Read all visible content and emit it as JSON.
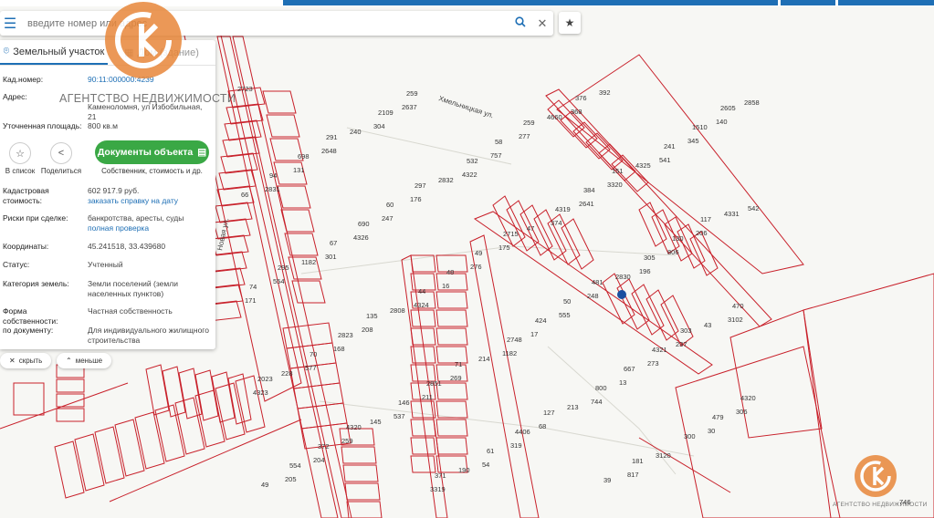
{
  "search": {
    "placeholder": "введите номер или адрес"
  },
  "tabs": [
    {
      "label": "Земельный участок"
    },
    {
      "label": "Дом (здание)"
    }
  ],
  "watermark": {
    "text": "АГЕНТСТВО НЕДВИЖИМОСТИ",
    "color": "#e8873a"
  },
  "info": {
    "cadnum_label": "Кад.номер:",
    "cadnum_value": "90:11:000000:4239",
    "address_label": "Адрес:",
    "address_value": "Каменоломня, ул Избобильная, 21",
    "area_label": "Уточненная площадь:",
    "area_value": "800 кв.м",
    "cost_label": "Кадастровая стоимость:",
    "cost_value": "602 917.9 руб.",
    "cost_link": "заказать справку на дату",
    "risks_label": "Риски при сделке:",
    "risks_value": "банкротства, аресты, суды",
    "risks_link": "полная проверка",
    "coords_label": "Координаты:",
    "coords_value": "45.241518, 33.439680",
    "status_label": "Статус:",
    "status_value": "Учтенный",
    "category_label": "Категория земель:",
    "category_value": "Земли поселений (земли населенных пунктов)",
    "ownership_label": "Форма собственности:",
    "ownership_value": "Частная собственность",
    "doc_label": "по документу:",
    "doc_value": "Для индивидуального жилищного строительства"
  },
  "actions": {
    "save_label": "В список",
    "share_label": "Поделиться",
    "docs_button": "Документы объекта",
    "docs_caption": "Собственник, стоимость и др."
  },
  "chips": {
    "hide": "скрыть",
    "less": "меньше"
  },
  "colors": {
    "accent": "#1e6fb5",
    "green": "#3aa845",
    "plot_line": "#c8202a",
    "marker": "#1a4fa0"
  },
  "streets": [
    "Хмельницкая ул.",
    "Новая ул."
  ],
  "plots": [
    "2723",
    "291",
    "297",
    "2715",
    "481",
    "303",
    "2023",
    "4320",
    "371",
    "259",
    "151",
    "117",
    "295",
    "135",
    "71",
    "127",
    "181",
    "2605",
    "698",
    "60",
    "49",
    "50",
    "4321",
    "4320",
    "372",
    "259",
    "58",
    "384",
    "130",
    "74",
    "2823",
    "2851",
    "4406",
    "39",
    "1510",
    "94",
    "690",
    "48",
    "424",
    "667",
    "479",
    "554",
    "2109",
    "532",
    "4319",
    "305",
    "470",
    "70",
    "146",
    "61",
    "376",
    "241",
    "66",
    "67",
    "44",
    "2748",
    "800",
    "300",
    "49",
    "240",
    "2832",
    "47",
    "2830",
    "43",
    "228",
    "145",
    "190",
    "4660",
    "4325",
    "4331",
    "1182",
    "2808",
    "214",
    "213",
    "3120",
    "2858",
    "2648",
    "176",
    "175",
    "248",
    "237",
    "4323",
    "259",
    "3319",
    "277",
    "3320",
    "206",
    "554",
    "208",
    "269",
    "68",
    "817",
    "140",
    "131",
    "247",
    "276",
    "555",
    "273",
    "306",
    "204",
    "2637",
    "757",
    "2641",
    "806",
    "171",
    "168",
    "211",
    "319",
    "392",
    "345",
    "2831",
    "4326",
    "16",
    "17",
    "13",
    "30",
    "205",
    "304",
    "4322",
    "374",
    "196",
    "3102",
    "577",
    "537",
    "54",
    "368",
    "541",
    "542",
    "301",
    "4324",
    "1182",
    "744"
  ],
  "corner_number": "746"
}
